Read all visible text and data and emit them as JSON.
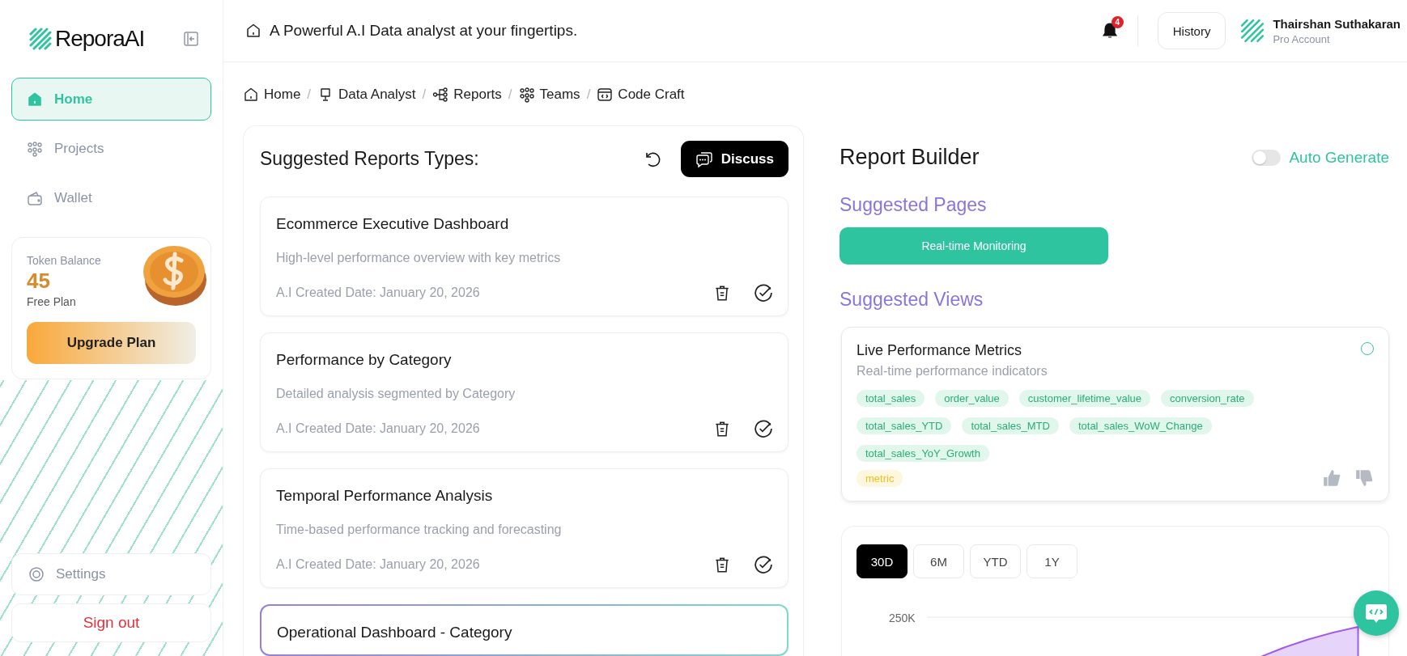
{
  "sidebar": {
    "logo": "ReporaAI",
    "items": [
      {
        "label": "Home",
        "selected": true
      },
      {
        "label": "Projects",
        "selected": false
      },
      {
        "label": "Wallet",
        "selected": false
      }
    ],
    "token_card": {
      "label": "Token Balance",
      "balance": "45",
      "plan": "Free Plan",
      "button": "Upgrade Plan"
    },
    "settings": "Settings",
    "sign_out": "Sign out"
  },
  "header": {
    "tagline": "A Powerful A.I Data analyst at your fingertips.",
    "notification_count": "4",
    "history_button": "History",
    "user_name": "Thairshan Suthakaran",
    "user_role": "Pro Account"
  },
  "breadcrumb": [
    {
      "label": "Home"
    },
    {
      "label": "Data Analyst",
      "separator": "/"
    },
    {
      "label": "Reports",
      "separator": "/"
    },
    {
      "label": "Teams",
      "separator": "/"
    },
    {
      "label": "Code Craft",
      "separator": "/"
    }
  ],
  "reports_panel": {
    "title": "Suggested Reports Types:",
    "discuss_button": "Discuss",
    "cards": [
      {
        "title": "Ecommerce Executive Dashboard",
        "description": "High-level performance overview with key metrics",
        "date": "A.I Created Date: January 20, 2026",
        "selected": false
      },
      {
        "title": "Performance by Category",
        "description": "Detailed analysis segmented by Category",
        "date": "A.I Created Date: January 20, 2026",
        "selected": false
      },
      {
        "title": "Temporal Performance Analysis",
        "description": "Time-based performance tracking and forecasting",
        "date": "A.I Created Date: January 20, 2026",
        "selected": false
      },
      {
        "title": "Operational Dashboard - Category",
        "selected": true
      }
    ]
  },
  "report_builder": {
    "title": "Report Builder",
    "auto_generate": {
      "label": "Auto Generate",
      "on": false
    },
    "pages_heading": "Suggested Pages",
    "pages": [
      "Real-time Monitoring"
    ],
    "views_heading": "Suggested Views",
    "view": {
      "title": "Live Performance Metrics",
      "subtitle": "Real-time performance indicators",
      "selected": false,
      "tags": [
        "total_sales",
        "order_value",
        "customer_lifetime_value",
        "conversion_rate",
        "total_sales_YTD",
        "total_sales_MTD",
        "total_sales_WoW_Change",
        "total_sales_YoY_Growth"
      ],
      "type_tag": "metric"
    },
    "chart": {
      "ranges": [
        {
          "label": "30D",
          "selected": true
        },
        {
          "label": "6M",
          "selected": false
        },
        {
          "label": "YTD",
          "selected": false
        },
        {
          "label": "1Y",
          "selected": false
        }
      ],
      "y_label": "250K"
    }
  }
}
